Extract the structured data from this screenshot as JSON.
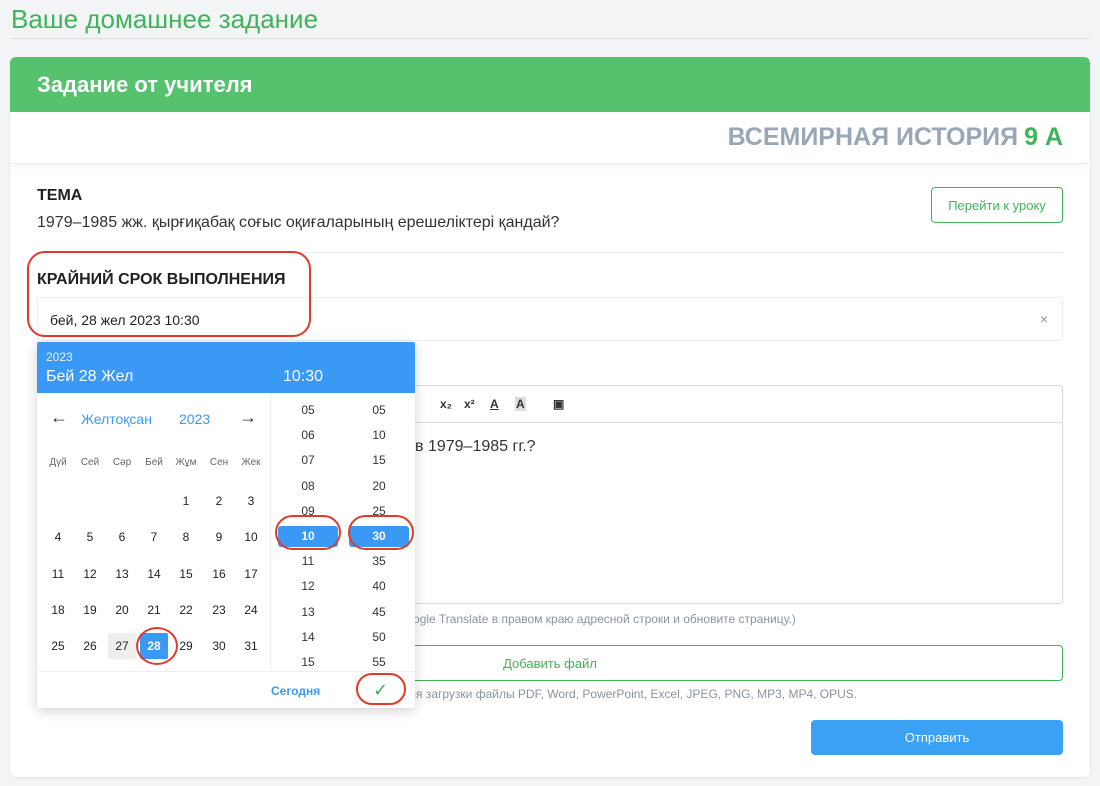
{
  "page": {
    "title": "Ваше домашнее задание"
  },
  "card": {
    "header": "Задание от учителя",
    "subject": "ВСЕМИРНАЯ ИСТОРИЯ",
    "class_badge": "9 А",
    "topic_label": "ТЕМА",
    "topic_text": "1979–1985 жж. қырғиқабақ соғыс оқиғаларының ерешеліктері қандай?",
    "go_to_lesson": "Перейти к уроку",
    "deadline_label": "КРАЙНИЙ СРОК ВЫПОЛНЕНИЯ",
    "deadline_value": "бей, 28 жел 2023 10:30",
    "clear_icon": "×"
  },
  "editor": {
    "toolbar": [
      "x₂",
      "x²",
      "A",
      "A",
      "▣"
    ],
    "body_text": "в 1979–1985 гг.?",
    "hint": "e Google Translate в правом краю адресной строки и обновите страницу.)"
  },
  "add_file": "Добавить файл",
  "upload_hint": "для загрузки файлы PDF, Word, PowerPoint, Excel, JPEG, PNG, MP3, MP4, OPUS.",
  "submit": "Отправить",
  "picker": {
    "year": "2023",
    "date": "Бей 28 Жел",
    "time": "10:30",
    "month": "Желтоқсан",
    "nav_year": "2023",
    "prev_arrow": "←",
    "next_arrow": "→",
    "weekdays": [
      "Дүй",
      "Сей",
      "Сәр",
      "Бей",
      "Жұм",
      "Сен",
      "Жек"
    ],
    "weeks": [
      [
        "",
        "",
        "",
        "",
        "1",
        "2",
        "3"
      ],
      [
        "4",
        "5",
        "6",
        "7",
        "8",
        "9",
        "10"
      ],
      [
        "11",
        "12",
        "13",
        "14",
        "15",
        "16",
        "17"
      ],
      [
        "18",
        "19",
        "20",
        "21",
        "22",
        "23",
        "24"
      ],
      [
        "25",
        "26",
        "27",
        "28",
        "29",
        "30",
        "31"
      ]
    ],
    "selected_day": "28",
    "muted_day": "27",
    "hours": [
      "05",
      "06",
      "07",
      "08",
      "09",
      "10",
      "11",
      "12",
      "13",
      "14",
      "15"
    ],
    "minutes": [
      "05",
      "10",
      "15",
      "20",
      "25",
      "30",
      "35",
      "40",
      "45",
      "50",
      "55"
    ],
    "selected_hour": "10",
    "selected_minute": "30",
    "today": "Сегодня",
    "confirm_icon": "✓"
  }
}
